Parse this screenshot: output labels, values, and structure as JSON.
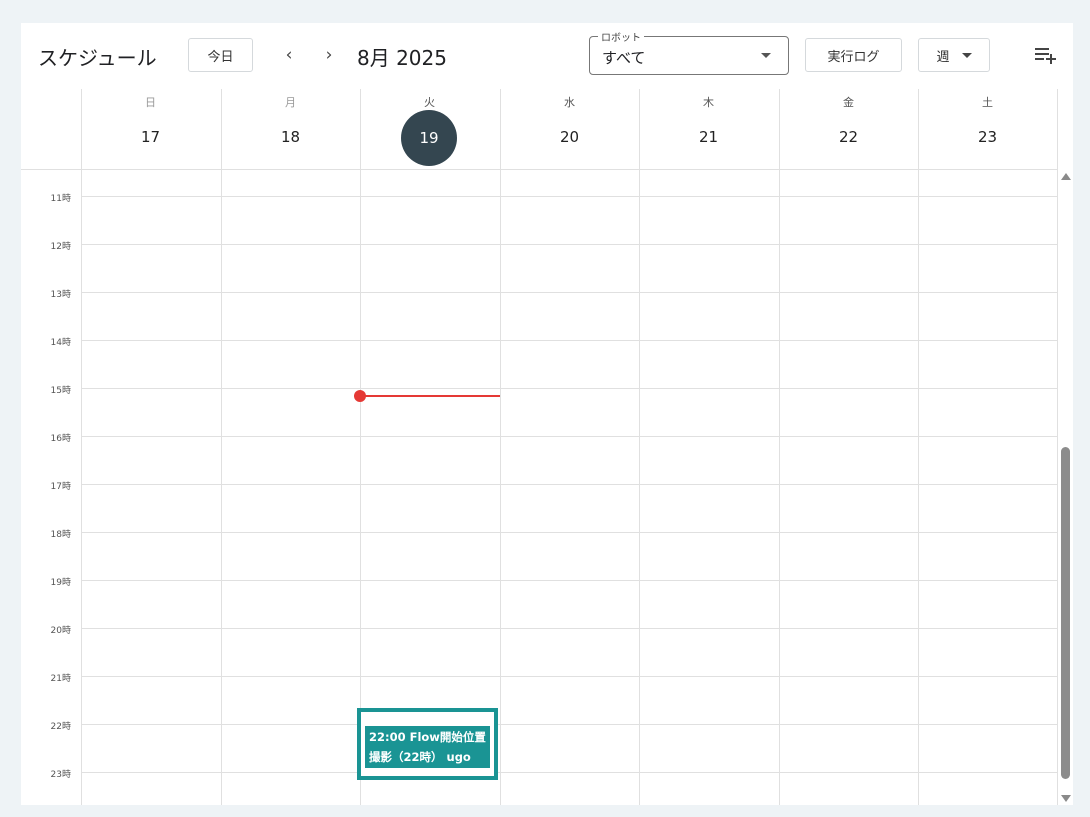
{
  "toolbar": {
    "title": "スケジュール",
    "today_label": "今日",
    "prev_label": "‹",
    "next_label": "›",
    "month_label": "8月 2025",
    "robot_select": {
      "legend": "ロボット",
      "value": "すべて"
    },
    "log_label": "実行ログ",
    "view_label": "週"
  },
  "week": {
    "days": [
      {
        "weekday": "日",
        "date": "17"
      },
      {
        "weekday": "月",
        "date": "18"
      },
      {
        "weekday": "火",
        "date": "19"
      },
      {
        "weekday": "水",
        "date": "20"
      },
      {
        "weekday": "木",
        "date": "21"
      },
      {
        "weekday": "金",
        "date": "22"
      },
      {
        "weekday": "土",
        "date": "23"
      }
    ],
    "today_index": 2
  },
  "hours": [
    "11時",
    "12時",
    "13時",
    "14時",
    "15時",
    "16時",
    "17時",
    "18時",
    "19時",
    "20時",
    "21時",
    "22時",
    "23時"
  ],
  "event": {
    "line1": "22:00 Flow開始位置",
    "line2": "撮影（22時） ugo"
  },
  "colors": {
    "accent": "#1a9494",
    "today_circle": "#344650",
    "now_indicator": "#e53935"
  }
}
